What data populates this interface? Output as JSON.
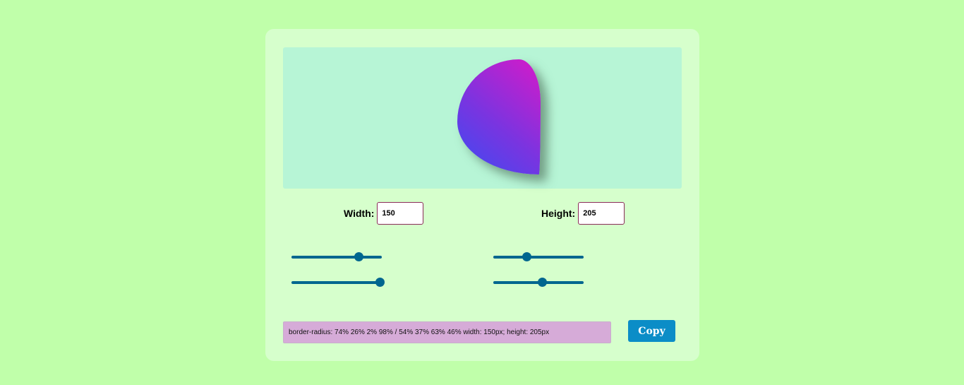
{
  "dimensions": {
    "width_label": "Width:",
    "width_value": "150",
    "height_label": "Height:",
    "height_value": "205"
  },
  "blob": {
    "border_radius": "74% 26% 2% 98% / 54% 37% 63% 46%",
    "gradient_colors": [
      "#3b4cf2",
      "#d61ac8"
    ]
  },
  "sliders": [
    {
      "name": "slider-top-left",
      "value_pct": 74
    },
    {
      "name": "slider-top-right",
      "value_pct": 37
    },
    {
      "name": "slider-bottom-left",
      "value_pct": 98
    },
    {
      "name": "slider-bottom-right",
      "value_pct": 54
    }
  ],
  "output": {
    "css_text": "border-radius: 74% 26% 2% 98% / 54% 37% 63% 46% width: 150px; height: 205px"
  },
  "copy_button": {
    "label": "Copy"
  },
  "colors": {
    "background": "#c0ffaa",
    "card": "#d6ffcc",
    "preview": "#b7f5d6",
    "slider": "#00668f",
    "output_bg": "#d6abd8",
    "button": "#0b8dc7"
  }
}
